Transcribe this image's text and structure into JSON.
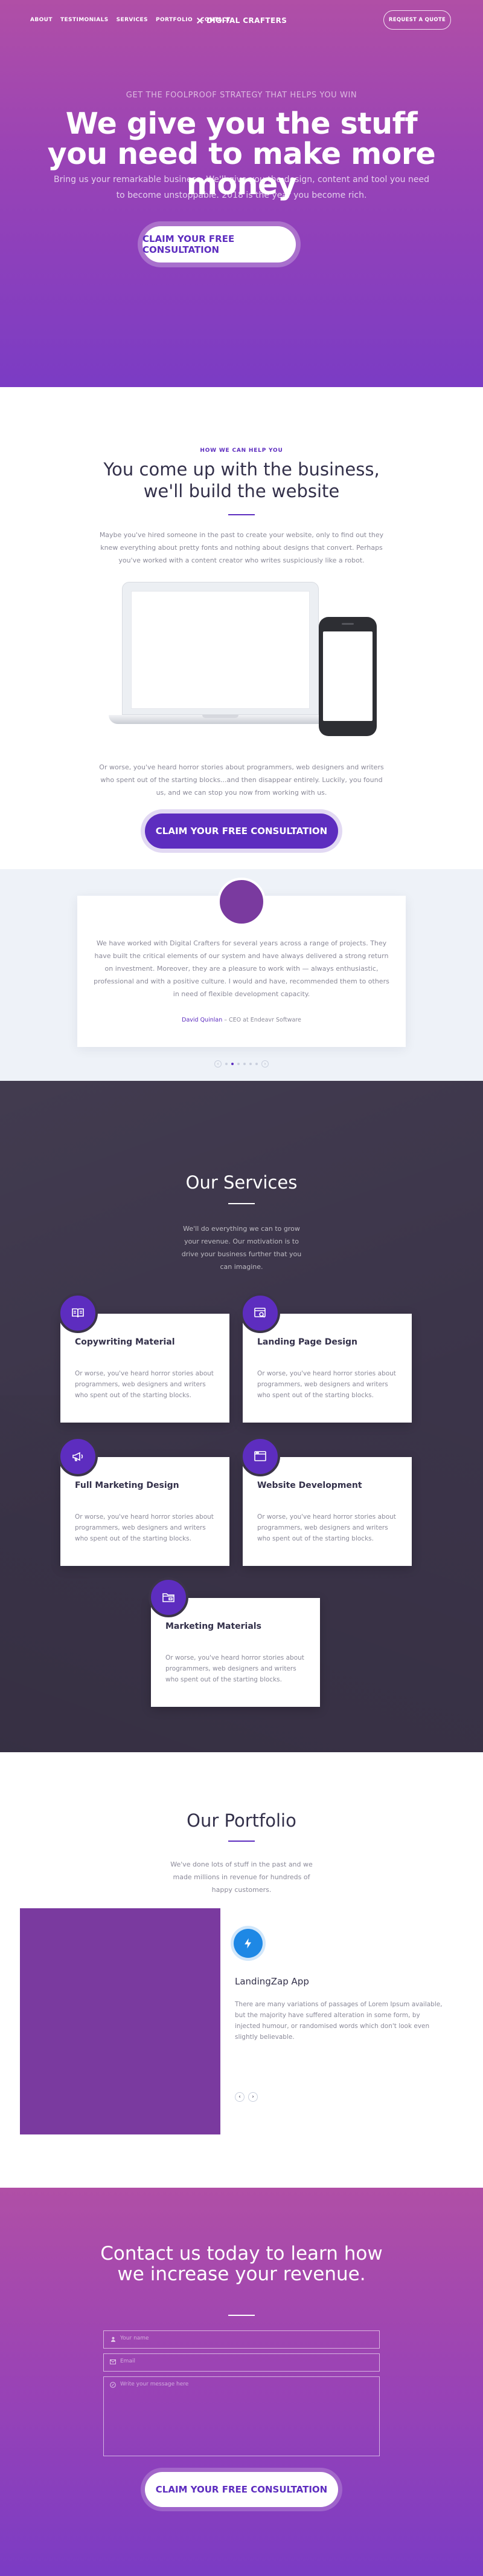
{
  "nav": {
    "links": [
      "ABOUT",
      "TESTIMONIALS",
      "SERVICES",
      "PORTFOLIO",
      "CONTACT"
    ],
    "logo": "DIGITAL CRAFTERS",
    "quote_button": "REQUEST A QUOTE"
  },
  "hero": {
    "kicker": "GET THE FOOLPROOF STRATEGY THAT HELPS YOU WIN",
    "title": "We give you the stuff you need to make more money",
    "subtitle": "Bring us your remarkable business. We'll give you the design, content and tool you need to become unstoppable. 2018 is the year you become rich.",
    "cta": "CLAIM YOUR FREE CONSULTATION"
  },
  "about": {
    "kicker": "HOW WE CAN HELP YOU",
    "title": "You come up with the business, we'll build the website",
    "intro": "Maybe you've hired someone in the past to create your website, only to find out they knew everything about pretty fonts and nothing about designs that convert. Perhaps you've worked with a content creator who writes suspiciously like a robot.",
    "body": "Or worse, you've heard horror stories about programmers, web designers and writers who spent out of the starting blocks...and then disappear entirely. Luckily, you found us, and we can stop you now from working with us.",
    "cta": "CLAIM YOUR FREE CONSULTATION"
  },
  "testimonial": {
    "quote": "We have worked with Digital Crafters for several years across a range of projects. They have built the critical elements of our system and have always delivered a strong return on investment. Moreover, they are a pleasure to work with — always enthusiastic, professional and with a positive culture. I would and have, recommended them to others in need of flexible development capacity.",
    "author_name": "David Quinlan",
    "author_role": " – CEO at Endeavr Software",
    "dot_count": 6,
    "active_dot": 1,
    "prev": "‹",
    "next": "›"
  },
  "services": {
    "title": "Our Services",
    "intro": "We'll do everything we can to grow your revenue. Our motivation is to drive your business further that you can imagine.",
    "items": [
      {
        "title": "Copywriting Material",
        "text": "Or worse, you've heard horror stories about programmers, web designers and writers who spent out of the starting blocks.",
        "icon": "book-icon"
      },
      {
        "title": "Landing Page Design",
        "text": "Or worse, you've heard horror stories about programmers, web designers and writers who spent out of the starting blocks.",
        "icon": "browser-search-icon"
      },
      {
        "title": "Full Marketing Design",
        "text": "Or worse, you've heard horror stories about programmers, web designers and writers who spent out of the starting blocks.",
        "icon": "megaphone-icon"
      },
      {
        "title": "Website Development",
        "text": "Or worse, you've heard horror stories about programmers, web designers and writers who spent out of the starting blocks.",
        "icon": "browser-window-icon"
      },
      {
        "title": "Marketing Materials",
        "text": "Or worse, you've heard horror stories about programmers, web designers and writers who spent out of the starting blocks.",
        "icon": "folder-icon"
      }
    ]
  },
  "portfolio": {
    "title": "Our Portfolio",
    "intro": "We've done lots of stuff in the past and we made millions in revenue for hundreds of happy customers.",
    "project_title": "LandingZap App",
    "project_text": "There are many variations of passages of Lorem Ipsum available, but the majority have suffered alteration in some form, by injected humour, or randomised words which don't look even slightly believable.",
    "prev": "‹",
    "next": "›"
  },
  "contact": {
    "title": "Contact us today to learn how we increase your revenue.",
    "name_placeholder": "Your name",
    "email_placeholder": "Email",
    "message_placeholder": "Write your message here",
    "cta": "CLAIM YOUR FREE CONSULTATION"
  },
  "colors": {
    "accent": "#5d2dbf",
    "dark_bg": "#3b3449",
    "hero_top": "#b04fa6",
    "hero_bottom": "#7b3cc4",
    "portfolio_image": "#7a3a9f",
    "bolt": "#1e88e5"
  }
}
